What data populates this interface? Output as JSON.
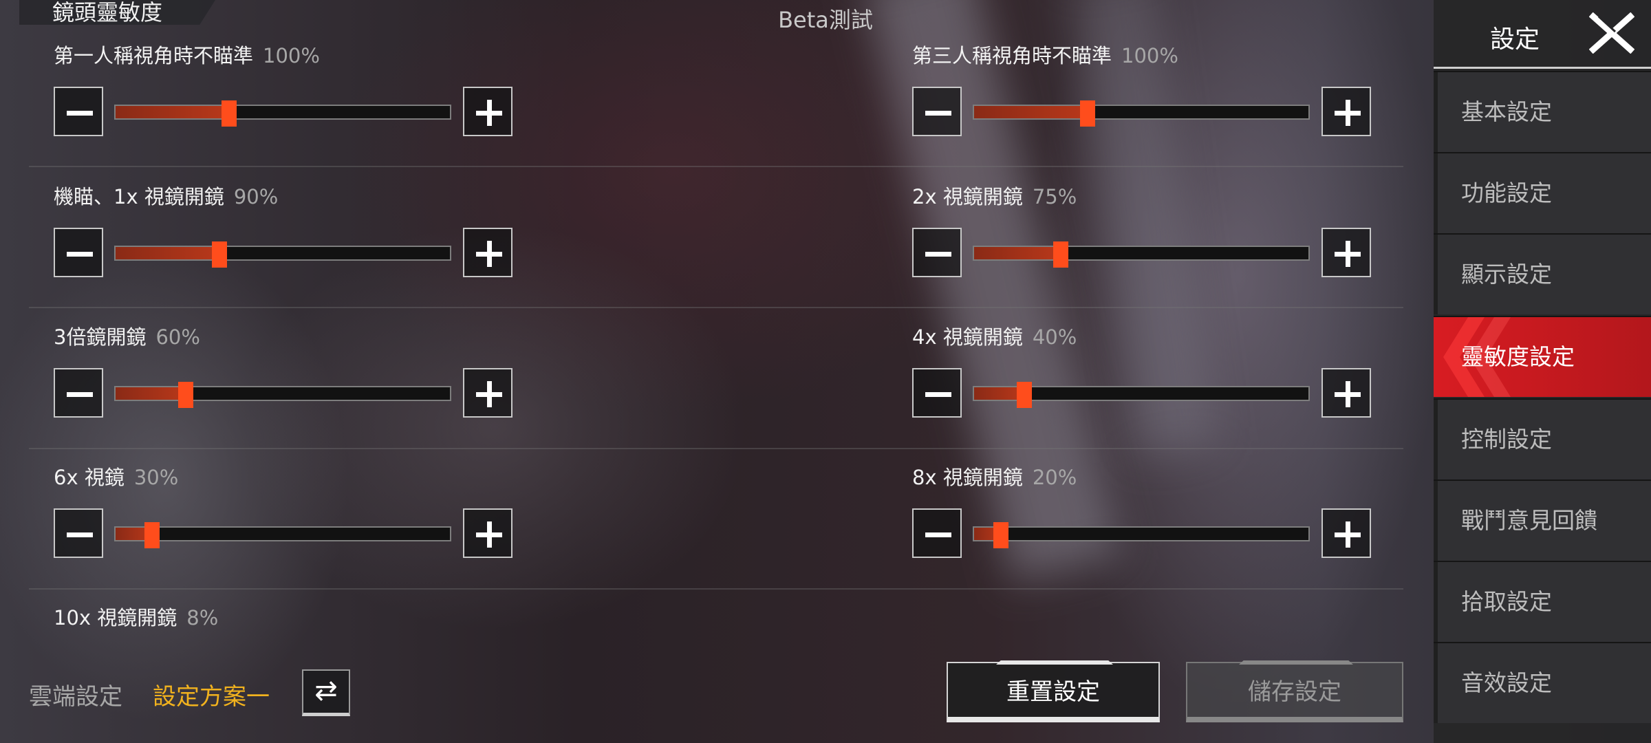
{
  "header": {
    "section": "鏡頭靈敏度",
    "beta": "Beta測試"
  },
  "settings": [
    {
      "label": "第一人稱視角時不瞄準",
      "value": "100%",
      "level": 0.34
    },
    {
      "label": "第三人稱視角時不瞄準",
      "value": "100%",
      "level": 0.34
    },
    {
      "label": "機瞄、1x 視鏡開鏡",
      "value": "90%",
      "level": 0.31
    },
    {
      "label": "2x 視鏡開鏡",
      "value": "75%",
      "level": 0.26
    },
    {
      "label": "3倍鏡開鏡",
      "value": "60%",
      "level": 0.21
    },
    {
      "label": "4x 視鏡開鏡",
      "value": "40%",
      "level": 0.15
    },
    {
      "label": "6x 視鏡",
      "value": "30%",
      "level": 0.11
    },
    {
      "label": "8x 視鏡開鏡",
      "value": "20%",
      "level": 0.08
    },
    {
      "label": "10x 視鏡開鏡",
      "value": "8%"
    }
  ],
  "bottom": {
    "cloud": "雲端設定",
    "scheme": "設定方案一",
    "swap_icon": "⇄",
    "reset": "重置設定",
    "save": "儲存設定"
  },
  "sidebar": {
    "title": "設定",
    "items": [
      {
        "label": "基本設定",
        "active": false
      },
      {
        "label": "功能設定",
        "active": false
      },
      {
        "label": "顯示設定",
        "active": false
      },
      {
        "label": "靈敏度設定",
        "active": true
      },
      {
        "label": "控制設定",
        "active": false
      },
      {
        "label": "戰鬥意見回饋",
        "active": false
      },
      {
        "label": "拾取設定",
        "active": false
      },
      {
        "label": "音效設定",
        "active": false
      }
    ]
  },
  "colors": {
    "accent": "#ff4d1c",
    "active_tab": "#d81c22",
    "scheme": "#f1b21e"
  }
}
